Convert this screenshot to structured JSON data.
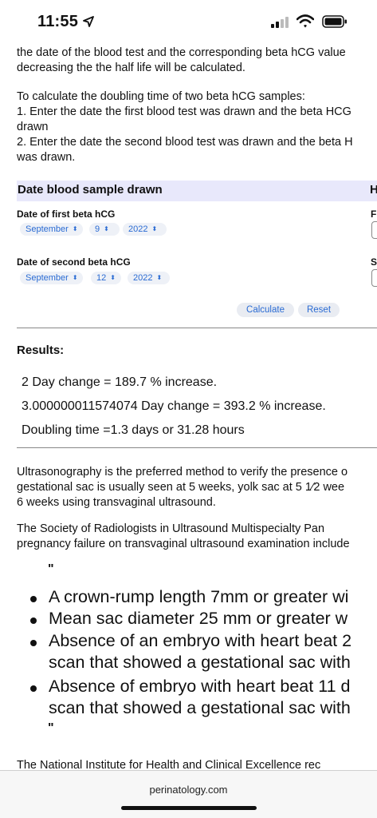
{
  "status": {
    "time": "11:55"
  },
  "intro": {
    "line1": "the date of the blood test and the corresponding beta hCG value",
    "line2": "decreasing the the half life will be calculated.",
    "instr_line1": "To calculate the doubling time of two beta hCG samples:",
    "instr_line2": "1. Enter the date the first blood test was drawn and the beta HCG",
    "instr_line3": "drawn",
    "instr_line4": "2. Enter the date the second blood test was drawn and the beta H",
    "instr_line5": "was drawn."
  },
  "form": {
    "header_title": "Date blood sample drawn",
    "header_right": "H",
    "first_label": "Date of first beta hCG",
    "first_month": "September",
    "first_day": "9",
    "first_year": "2022",
    "first_right_label": "F",
    "second_label": "Date of second  beta hCG",
    "second_month": "September",
    "second_day": "12",
    "second_year": "2022",
    "second_right_label": "S",
    "calculate_label": "Calculate",
    "reset_label": "Reset"
  },
  "results": {
    "label": "Results:",
    "line1": "2 Day change = 189.7 % increase.",
    "line2": "3.000000011574074 Day change = 393.2 % increase.",
    "line3": "Doubling time =1.3 days or 31.28 hours"
  },
  "article": {
    "p1_line1": "Ultrasonography is the preferred method to verify the presence o",
    "p1_line2": "gestational sac is usually seen at 5 weeks, yolk sac at 5 1⁄2 wee",
    "p1_line3": "6 weeks using transvaginal ultrasound.",
    "p2_line1": "The  Society  of  Radiologists  in  Ultrasound  Multispecialty  Pan",
    "p2_line2": "pregnancy failure on transvaginal ultrasound examination include",
    "quote_open": "\"",
    "quote_close": "\"",
    "bullet1": "A crown-rump length 7mm or greater wi",
    "bullet2": "Mean sac diameter 25 mm or greater w",
    "bullet3_line1": "Absence of an embryo with heart beat 2",
    "bullet3_line2": "scan that showed a gestational sac with",
    "bullet4_line1": "Absence of embryo with heart beat 11 d",
    "bullet4_line2": "scan that showed a gestational sac with",
    "p3_line1": "The  National  Institute  for  Health  and  Clinical  Excellence  rec"
  },
  "browser": {
    "url": "perinatology.com"
  }
}
